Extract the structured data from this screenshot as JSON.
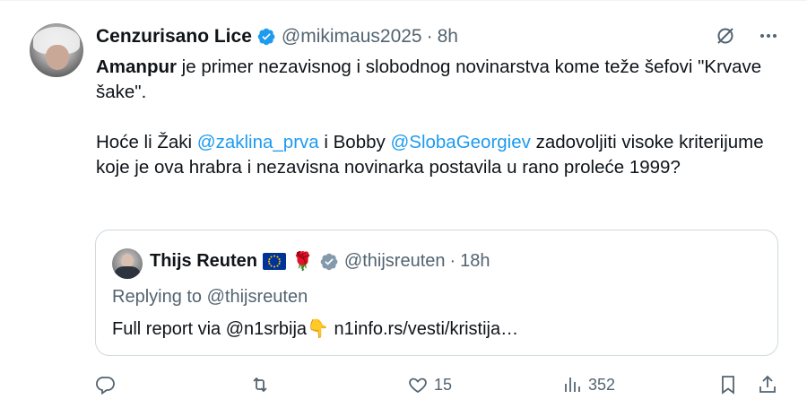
{
  "tweet": {
    "author_name": "Cenzurisano Lice",
    "handle": "@mikimaus2025",
    "separator": "·",
    "time": "8h",
    "text_bold": "Amanpur",
    "text_line1_rest": " je primer nezavisnog i slobodnog novinarstva kome teže šefovi \"Krvave šake\".",
    "text_p2_a": "Hoće li Žaki ",
    "mention1": "@zaklina_prva",
    "text_p2_b": " i Bobby ",
    "mention2": "@SlobaGeorgiev",
    "text_p2_c": " zadovoljiti visoke kriterijume koje je ova hrabra i nezavisna novinarka postavila u rano proleće 1999?"
  },
  "quote": {
    "author_name": "Thijs Reuten",
    "rose_emoji": "🌹",
    "handle": "@thijsreuten",
    "separator": "·",
    "time": "18h",
    "replying_to": "Replying to @thijsreuten",
    "text": "Full report via @n1srbija👇 n1info.rs/vesti/kristija…"
  },
  "actions": {
    "replies": "",
    "reposts": "",
    "likes": "15",
    "views": "352"
  },
  "colors": {
    "accent": "#1d9bf0",
    "secondary_text": "#536471",
    "border": "#cfd9de"
  },
  "icons": [
    "verified-badge-icon",
    "grok-icon",
    "more-icon",
    "reply-icon",
    "repost-icon",
    "like-icon",
    "views-icon",
    "bookmark-icon",
    "share-icon",
    "eu-flag-icon",
    "rose-icon"
  ]
}
